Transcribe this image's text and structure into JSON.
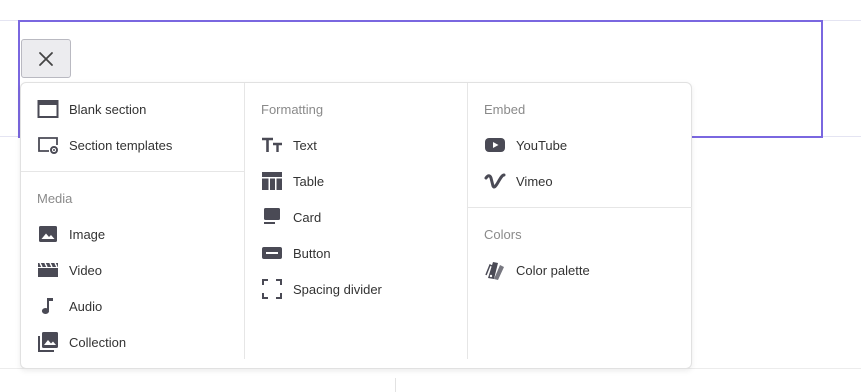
{
  "close_button": {
    "icon": "close-icon"
  },
  "menu": {
    "column1": {
      "items": [
        {
          "label": "Blank section",
          "icon": "blank-section-icon"
        },
        {
          "label": "Section templates",
          "icon": "section-templates-icon"
        }
      ],
      "media": {
        "heading": "Media",
        "items": [
          {
            "label": "Image",
            "icon": "image-icon"
          },
          {
            "label": "Video",
            "icon": "video-icon"
          },
          {
            "label": "Audio",
            "icon": "audio-icon"
          },
          {
            "label": "Collection",
            "icon": "collection-icon"
          }
        ]
      }
    },
    "column2": {
      "formatting": {
        "heading": "Formatting",
        "items": [
          {
            "label": "Text",
            "icon": "text-icon"
          },
          {
            "label": "Table",
            "icon": "table-icon"
          },
          {
            "label": "Card",
            "icon": "card-icon"
          },
          {
            "label": "Button",
            "icon": "button-icon"
          },
          {
            "label": "Spacing divider",
            "icon": "spacing-divider-icon"
          }
        ]
      }
    },
    "column3": {
      "embed": {
        "heading": "Embed",
        "items": [
          {
            "label": "YouTube",
            "icon": "youtube-icon"
          },
          {
            "label": "Vimeo",
            "icon": "vimeo-icon"
          }
        ]
      },
      "colors": {
        "heading": "Colors",
        "items": [
          {
            "label": "Color palette",
            "icon": "color-palette-icon"
          }
        ]
      }
    }
  },
  "colors": {
    "selection_outline": "#7a67e0",
    "icon": "#4a4a55",
    "heading": "#8a8a8a"
  }
}
